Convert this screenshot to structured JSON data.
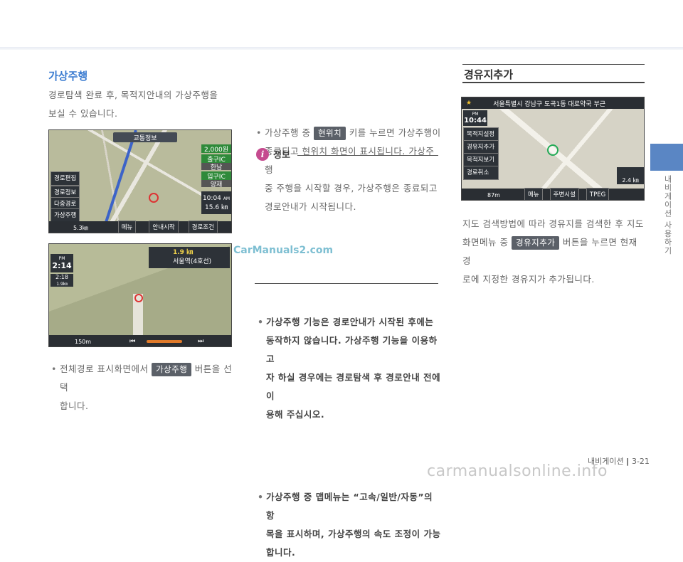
{
  "left": {
    "heading": "가상주행",
    "intro_1": "경로탐색 완료 후, 목적지안내의 가상주행을",
    "intro_2": "보실 수 있습니다.",
    "bullet_pre": "전체경로 표시화면에서",
    "bullet_chip": "가상주행",
    "bullet_post": "버튼을 선택",
    "bullet_line2": "합니다."
  },
  "shot1": {
    "top_title": "교통정보",
    "menu_items": [
      "경로편집",
      "경로정보",
      "다중경로",
      "가상주행"
    ],
    "toll": "2,000원",
    "exit1": "출구IC",
    "exit1_sub": "한남",
    "exit2": "입구IC",
    "exit2_sub": "양재",
    "time": "10:04",
    "ampm": "AM",
    "dist": "15.6 ㎞",
    "scale": "5.3㎞",
    "bottom_buttons": [
      "메뉴",
      "안내시작",
      "경로조건"
    ]
  },
  "shot2": {
    "clock_label": "PM",
    "clock": "2:14",
    "eta": "2:18",
    "eta_sub": "1.9㎞",
    "dist": "1.9 ㎞",
    "station": "서울역(4호선)",
    "scale": "150m"
  },
  "middle": {
    "b1_pre": "가상주행 중",
    "b1_chip": "현위치",
    "b1_post": "키를 누르면 가상주행이",
    "b1_l2": "종료되고 현위치 화면이 표시됩니다. 가상주행",
    "b1_l3": "중 주행을 시작할 경우, 가상주행은 종료되고",
    "b1_l4": "경로안내가 시작됩니다.",
    "info_title": "정보",
    "i1_l1": "가상주행 기능은 경로안내가 시작된 후에는",
    "i1_l2": "동작하지 않습니다. 가상주행 기능을 이용하고",
    "i1_l3": "자 하실 경우에는 경로탐색 후 경로안내 전에 이",
    "i1_l4": "용해 주십시오.",
    "i2_l1": "가상주행 중 맵메뉴는 “고속/일반/자동”의 항",
    "i2_l2": "목을 표시하며, 가상주행의 속도 조정이 가능",
    "i2_l3": "합니다."
  },
  "right": {
    "heading": "경유지추가",
    "location": "서울특별시 강남구 도곡1동 대로약국 부근",
    "clock_label": "PM",
    "clock": "10:44",
    "menu_items": [
      "목적지설정",
      "경유지추가",
      "목적지보기",
      "경로취소"
    ],
    "scale": "87m",
    "bottom_buttons": [
      "메뉴",
      "주변시설",
      "TPEG"
    ],
    "dist": "2.4 ㎞",
    "p_l1": "지도 검색방법에 따라 경유지를 검색한 후 지도",
    "p_l2_pre": "화면메뉴 중",
    "p_l2_chip": "경유지추가",
    "p_l2_post": "버튼을 누르면 현재 경",
    "p_l3": "로에 지정한 경유지가 추가됩니다."
  },
  "side_tab_label": "내비게이션 사용하기",
  "footer": {
    "section": "내비게이션",
    "page": "3-21"
  },
  "watermark": "CarManuals2.com",
  "footer_watermark": "carmanualsonline.info"
}
